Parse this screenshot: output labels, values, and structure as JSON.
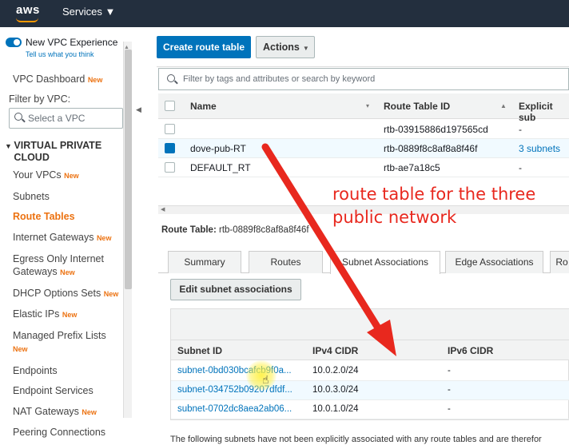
{
  "topnav": {
    "logo": "aws",
    "services_label": "Services ▼"
  },
  "sidebar": {
    "vpc_experience": "New VPC Experience",
    "tell_us": "Tell us what you think",
    "dashboard": "VPC Dashboard",
    "new_badge": "New",
    "filter_label": "Filter by VPC:",
    "select_placeholder": "Select a VPC",
    "section_header": "VIRTUAL PRIVATE CLOUD",
    "items": [
      {
        "label": "Your VPCs",
        "new": true
      },
      {
        "label": "Subnets",
        "new": false
      },
      {
        "label": "Route Tables",
        "new": false,
        "active": true
      },
      {
        "label": "Internet Gateways",
        "new": true
      },
      {
        "label": "Egress Only Internet Gateways",
        "new": true
      },
      {
        "label": "DHCP Options Sets",
        "new": true
      },
      {
        "label": "Elastic IPs",
        "new": true
      },
      {
        "label": "Managed Prefix Lists",
        "new": true
      },
      {
        "label": "Endpoints",
        "new": false
      },
      {
        "label": "Endpoint Services",
        "new": false
      },
      {
        "label": "NAT Gateways",
        "new": true
      },
      {
        "label": "Peering Connections",
        "new": false
      }
    ]
  },
  "toolbar": {
    "create_label": "Create route table",
    "actions_label": "Actions"
  },
  "search": {
    "placeholder": "Filter by tags and attributes or search by keyword"
  },
  "grid": {
    "headers": {
      "name": "Name",
      "id": "Route Table ID",
      "explicit": "Explicit sub"
    },
    "rows": [
      {
        "name": "",
        "id": "rtb-03915886d197565cd",
        "explicit": "-",
        "checked": false
      },
      {
        "name": "dove-pub-RT",
        "id": "rtb-0889f8c8af8a8f46f",
        "explicit": "3 subnets",
        "checked": true
      },
      {
        "name": "DEFAULT_RT",
        "id": "rtb-ae7a18c5",
        "explicit": "-",
        "checked": false
      }
    ]
  },
  "detail": {
    "title_label": "Route Table:",
    "title_value": "rtb-0889f8c8af8a8f46f",
    "tabs": [
      "Summary",
      "Routes",
      "Subnet Associations",
      "Edge Associations",
      "Ro"
    ],
    "active_tab": 2,
    "edit_label": "Edit subnet associations",
    "sub_headers": {
      "id": "Subnet ID",
      "ipv4": "IPv4 CIDR",
      "ipv6": "IPv6 CIDR"
    },
    "subnets": [
      {
        "id": "subnet-0bd030bcafcb9f0a...",
        "ipv4": "10.0.2.0/24",
        "ipv6": "-"
      },
      {
        "id": "subnet-034752b09207dfdf...",
        "ipv4": "10.0.3.0/24",
        "ipv6": "-"
      },
      {
        "id": "subnet-0702dc8aea2ab06...",
        "ipv4": "10.0.1.0/24",
        "ipv6": "-"
      }
    ],
    "footnote": "The following subnets have not been explicitly associated with any route tables and are therefor"
  },
  "annotation": {
    "line1": "route table for the three",
    "line2": "public network",
    "color": "#e8281e"
  },
  "colors": {
    "nav": "#232f3e",
    "accent": "#0073bb",
    "active": "#ec7211"
  }
}
